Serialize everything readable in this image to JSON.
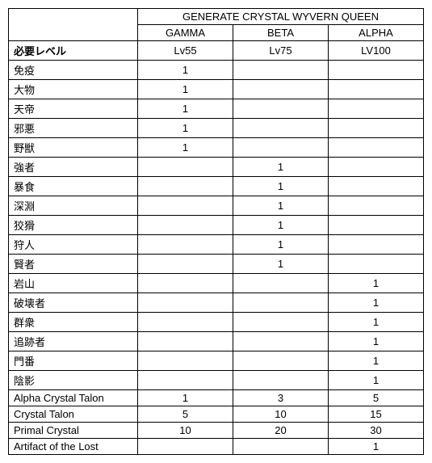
{
  "chart_data": {
    "type": "table",
    "title": "GENERATE CRYSTAL WYVERN QUEEN",
    "columns": [
      "GAMMA",
      "BETA",
      "ALPHA"
    ],
    "level_label": "必要レベル",
    "levels": [
      "Lv55",
      "Lv75",
      "LV100"
    ],
    "rows": [
      {
        "label": "免疫",
        "values": [
          "1",
          "",
          ""
        ]
      },
      {
        "label": "大物",
        "values": [
          "1",
          "",
          ""
        ]
      },
      {
        "label": "天帝",
        "values": [
          "1",
          "",
          ""
        ]
      },
      {
        "label": "邪悪",
        "values": [
          "1",
          "",
          ""
        ]
      },
      {
        "label": "野獣",
        "values": [
          "1",
          "",
          ""
        ]
      },
      {
        "label": "強者",
        "values": [
          "",
          "1",
          ""
        ]
      },
      {
        "label": "暴食",
        "values": [
          "",
          "1",
          ""
        ]
      },
      {
        "label": "深淵",
        "values": [
          "",
          "1",
          ""
        ]
      },
      {
        "label": "狡猾",
        "values": [
          "",
          "1",
          ""
        ]
      },
      {
        "label": "狩人",
        "values": [
          "",
          "1",
          ""
        ]
      },
      {
        "label": "賢者",
        "values": [
          "",
          "1",
          ""
        ]
      },
      {
        "label": "岩山",
        "values": [
          "",
          "",
          "1"
        ]
      },
      {
        "label": "破壊者",
        "values": [
          "",
          "",
          "1"
        ]
      },
      {
        "label": "群衆",
        "values": [
          "",
          "",
          "1"
        ]
      },
      {
        "label": "追跡者",
        "values": [
          "",
          "",
          "1"
        ]
      },
      {
        "label": "門番",
        "values": [
          "",
          "",
          "1"
        ]
      },
      {
        "label": "陰影",
        "values": [
          "",
          "",
          "1"
        ]
      },
      {
        "label": "Alpha Crystal Talon",
        "values": [
          "1",
          "3",
          "5"
        ]
      },
      {
        "label": "Crystal Talon",
        "values": [
          "5",
          "10",
          "15"
        ]
      },
      {
        "label": "Primal Crystal",
        "values": [
          "10",
          "20",
          "30"
        ]
      },
      {
        "label": "Artifact of the Lost",
        "values": [
          "",
          "",
          "1"
        ]
      }
    ]
  }
}
